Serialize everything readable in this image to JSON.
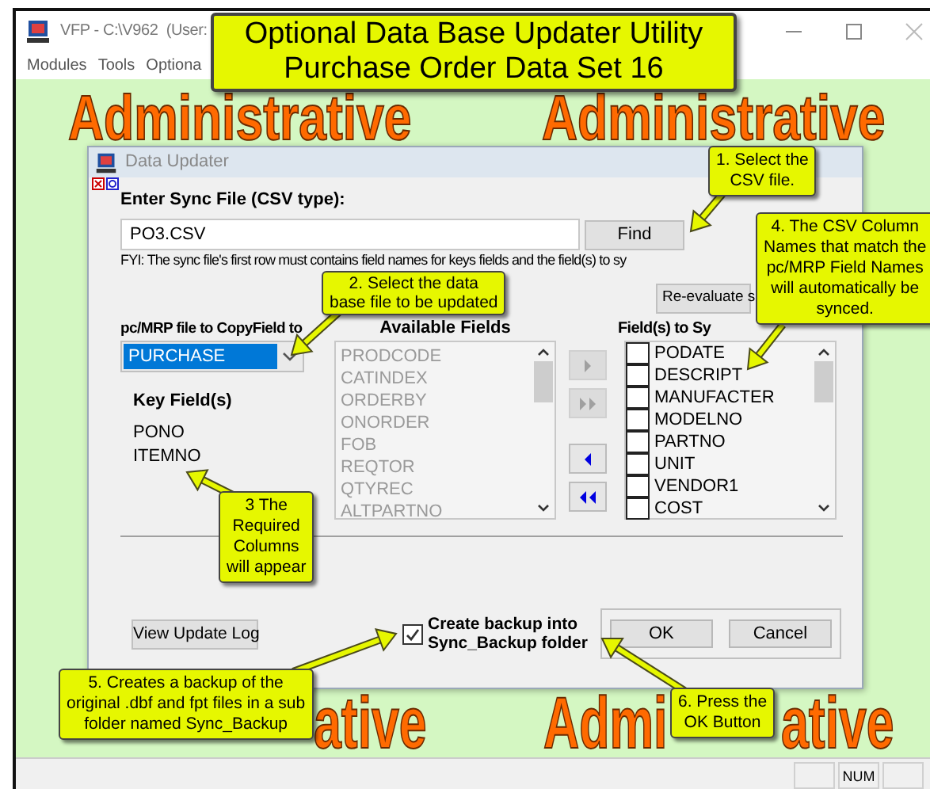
{
  "window": {
    "title": "VFP - C:\\V962  (User:"
  },
  "menu": [
    "Modules",
    "Tools",
    "Optiona"
  ],
  "banner": {
    "lines": [
      "Optional Data Base Updater Utility",
      "Purchase Order Data Set 16"
    ]
  },
  "background_text": [
    "Administrative",
    "Administrative",
    "ative",
    "Admi",
    "ative"
  ],
  "dialog": {
    "title": "Data Updater",
    "sync_file_label": "Enter Sync File (CSV type):",
    "sync_file": {
      "value": "PO3.CSV"
    },
    "find_button": "Find",
    "note": "FYI: The sync file's first row must contains field names for keys fields and the field(s) to sy",
    "reevaluate_button": "Re-evaluate s",
    "target_label": "pc/MRP file to CopyField to",
    "target_file": {
      "value": "PURCHASE",
      "selected": true
    },
    "key_fields_label": "Key Field(s)",
    "key_fields": [
      "PONO",
      "ITEMNO"
    ],
    "available_label": "Available Fields",
    "available_fields": {
      "disabled": true,
      "items": [
        "PRODCODE",
        "CATINDEX",
        "ORDERBY",
        "ONORDER",
        "FOB",
        "REQTOR",
        "QTYREC",
        "ALTPARTNO"
      ]
    },
    "move_buttons": [
      {
        "kind": "add",
        "disabled": true
      },
      {
        "kind": "add_all",
        "disabled": true
      },
      {
        "kind": "remove",
        "disabled": false
      },
      {
        "kind": "remove_all",
        "disabled": false
      }
    ],
    "sync_label": "Field(s) to Sy",
    "sync_fields": [
      {
        "name": "PODATE",
        "checked": false
      },
      {
        "name": "DESCRIPT",
        "checked": false
      },
      {
        "name": "MANUFACTER",
        "checked": false
      },
      {
        "name": "MODELNO",
        "checked": false
      },
      {
        "name": "PARTNO",
        "checked": false
      },
      {
        "name": "UNIT",
        "checked": false
      },
      {
        "name": "VENDOR1",
        "checked": false
      },
      {
        "name": "COST",
        "checked": false
      }
    ],
    "log_button": "View Update Log",
    "backup": {
      "label_lines": [
        "Create backup into",
        "Sync_Backup folder"
      ],
      "checked": true
    },
    "ok_button": "OK",
    "cancel_button": "Cancel"
  },
  "callouts": [
    {
      "lines": [
        "1.  Select the",
        "CSV file."
      ]
    },
    {
      "lines": [
        "2. Select the data",
        "base file to be updated"
      ]
    },
    {
      "lines": [
        "4. The CSV Column",
        "Names that match the",
        "pc/MRP Field Names",
        "will automatically be",
        "synced."
      ]
    },
    {
      "lines": [
        "3 The",
        "Required",
        "Columns",
        "will appear"
      ]
    },
    {
      "lines": [
        "5. Creates a backup of the",
        "original .dbf and fpt files in a sub",
        "folder named Sync_Backup"
      ]
    },
    {
      "lines": [
        "6. Press the",
        "OK Button"
      ]
    }
  ],
  "status_bar": {
    "indicator": "NUM"
  }
}
